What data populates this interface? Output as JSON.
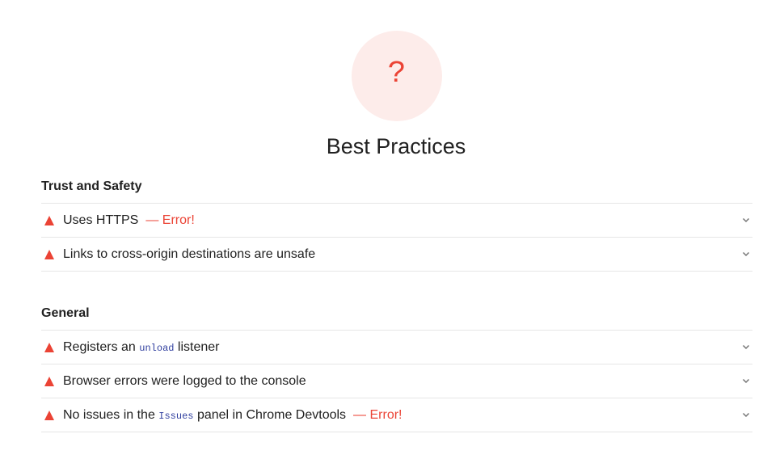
{
  "gauge": {
    "mark": "?",
    "color": "#eb4335",
    "background": "#fdecea"
  },
  "category": {
    "title": "Best Practices"
  },
  "groups": [
    {
      "title": "Trust and Safety",
      "audits": [
        {
          "status": "fail",
          "icon": "fail-triangle-icon",
          "text_before": "Uses HTTPS",
          "code": "",
          "text_after": "",
          "error": "— Error!"
        },
        {
          "status": "fail",
          "icon": "fail-triangle-icon",
          "text_before": "Links to cross-origin destinations are unsafe",
          "code": "",
          "text_after": "",
          "error": ""
        }
      ]
    },
    {
      "title": "General",
      "audits": [
        {
          "status": "fail",
          "icon": "fail-triangle-icon",
          "text_before": "Registers an ",
          "code": "unload",
          "text_after": " listener",
          "error": ""
        },
        {
          "status": "fail",
          "icon": "fail-triangle-icon",
          "text_before": "Browser errors were logged to the console",
          "code": "",
          "text_after": "",
          "error": ""
        },
        {
          "status": "fail",
          "icon": "fail-triangle-icon",
          "text_before": "No issues in the ",
          "code": "Issues",
          "text_after": " panel in Chrome Devtools",
          "error": "— Error!"
        }
      ]
    }
  ],
  "colors": {
    "fail": "#eb4335",
    "code": "#303f9f",
    "divider": "#e6e6e6",
    "text": "#212121"
  }
}
